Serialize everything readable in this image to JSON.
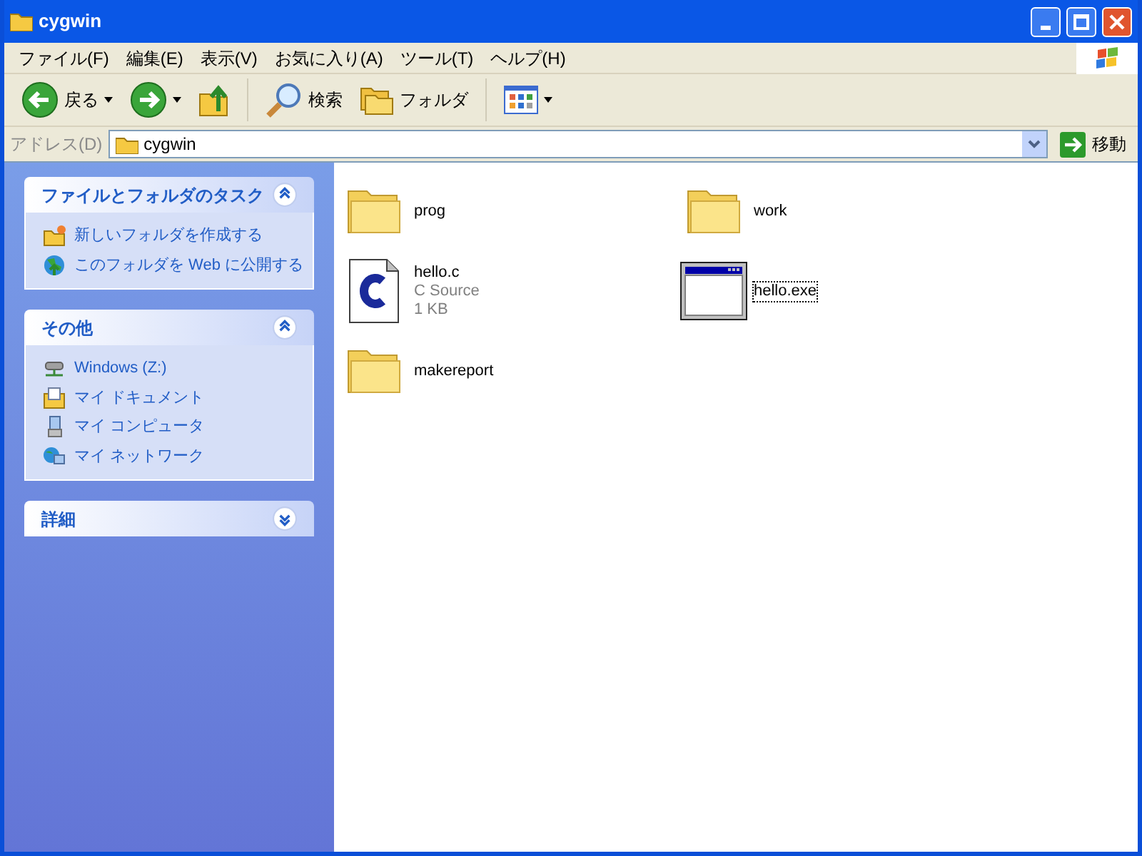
{
  "window": {
    "title": "cygwin"
  },
  "menu": [
    "ファイル(F)",
    "編集(E)",
    "表示(V)",
    "お気に入り(A)",
    "ツール(T)",
    "ヘルプ(H)"
  ],
  "toolbar": [
    {
      "kind": "back",
      "label": "戻る"
    },
    {
      "kind": "forward"
    },
    {
      "kind": "up"
    },
    {
      "kind": "search",
      "label": "検索"
    },
    {
      "kind": "folders",
      "label": "フォルダ"
    },
    {
      "kind": "views"
    }
  ],
  "address": {
    "label": "アドレス(D)",
    "value": "cygwin",
    "go": "移動"
  },
  "sidebar": [
    {
      "title": "ファイルとフォルダのタスク",
      "expanded": true,
      "items": [
        {
          "kind": "newfolder",
          "label": "新しいフォルダを作成する"
        },
        {
          "kind": "web",
          "label": "このフォルダを Web に公開する"
        }
      ]
    },
    {
      "title": "その他",
      "expanded": true,
      "items": [
        {
          "kind": "drive",
          "label": "Windows (Z:)"
        },
        {
          "kind": "documents",
          "label": "マイ ドキュメント"
        },
        {
          "kind": "computer",
          "label": "マイ コンピュータ"
        },
        {
          "kind": "network",
          "label": "マイ ネットワーク"
        }
      ]
    },
    {
      "title": "詳細",
      "expanded": false
    }
  ],
  "files": [
    {
      "kind": "folder",
      "name": "prog",
      "focused": false
    },
    {
      "kind": "folder",
      "name": "work",
      "focused": false
    },
    {
      "kind": "csource",
      "name": "hello.c",
      "type": "C Source",
      "size": "1 KB",
      "focused": false
    },
    {
      "kind": "exe",
      "name": "hello.exe",
      "focused": true
    },
    {
      "kind": "folder",
      "name": "makereport",
      "focused": false
    }
  ]
}
